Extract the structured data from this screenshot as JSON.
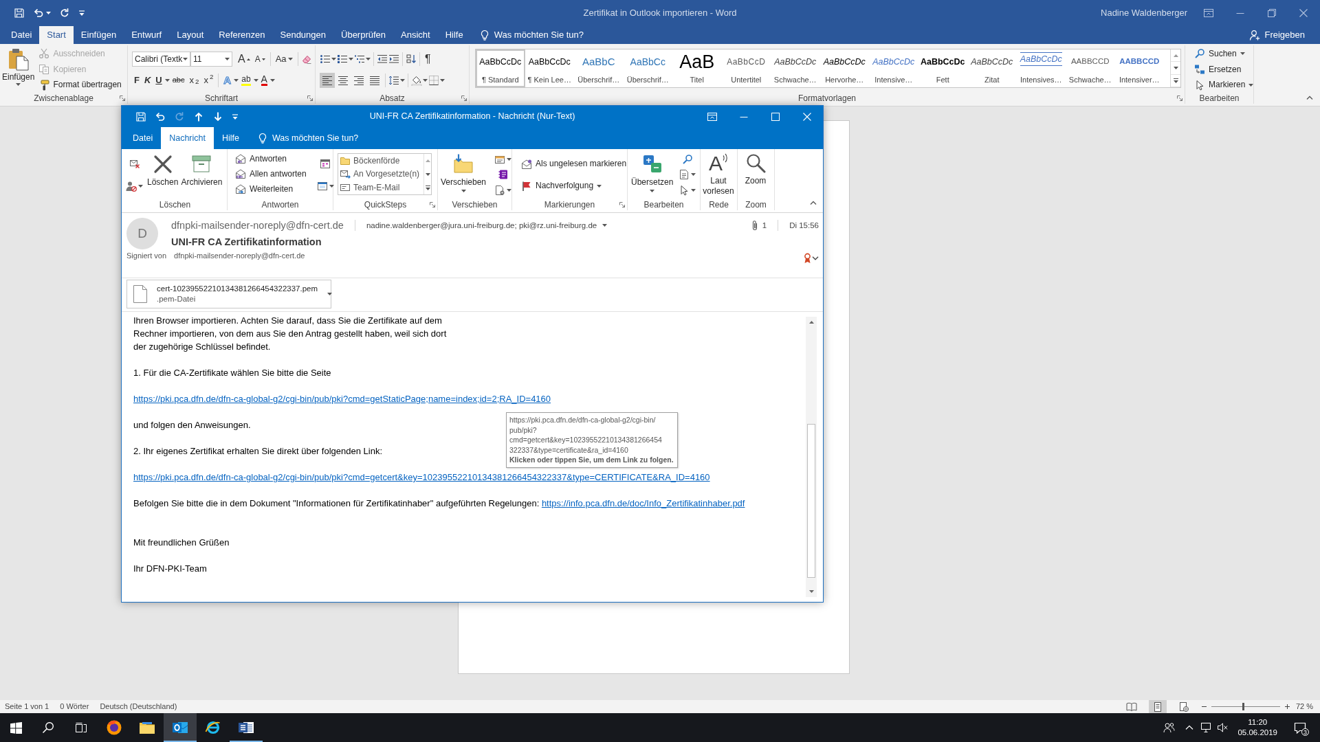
{
  "word": {
    "title": "Zertifikat in Outlook importieren - Word",
    "user": "Nadine Waldenberger",
    "tabs": [
      {
        "label": "Datei",
        "selected": false
      },
      {
        "label": "Start",
        "selected": true
      },
      {
        "label": "Einfügen",
        "selected": false
      },
      {
        "label": "Entwurf",
        "selected": false
      },
      {
        "label": "Layout",
        "selected": false
      },
      {
        "label": "Referenzen",
        "selected": false
      },
      {
        "label": "Sendungen",
        "selected": false
      },
      {
        "label": "Überprüfen",
        "selected": false
      },
      {
        "label": "Ansicht",
        "selected": false
      },
      {
        "label": "Hilfe",
        "selected": false
      }
    ],
    "tell_me": "Was möchten Sie tun?",
    "share": "Freigeben"
  },
  "ribbon": {
    "clipboard": {
      "label": "Zwischenablage",
      "paste": "Einfügen",
      "items": [
        {
          "kind": "cut",
          "label": "Ausschneiden",
          "disabled": true
        },
        {
          "kind": "copy",
          "label": "Kopieren",
          "disabled": true
        },
        {
          "kind": "painter",
          "label": "Format übertragen",
          "disabled": false
        }
      ]
    },
    "font": {
      "label": "Schriftart",
      "name": "Calibri (Textk",
      "size": "11",
      "size_buttons": [
        {
          "kind": "grow",
          "label": "A"
        },
        {
          "kind": "shrink",
          "label": "A"
        }
      ],
      "case": "Aa",
      "format": [
        {
          "kind": "bold",
          "label": "F"
        },
        {
          "kind": "italic",
          "label": "K"
        },
        {
          "kind": "underline",
          "label": "U"
        },
        {
          "kind": "strike",
          "label": "abc"
        },
        {
          "kind": "sub",
          "label": "x$_{2}$"
        },
        {
          "kind": "sup",
          "label": "x$^{2}$"
        }
      ],
      "effects": [
        {
          "kind": "effects",
          "label": "A"
        },
        {
          "kind": "highlight",
          "label": "ab"
        },
        {
          "kind": "color",
          "label": "A"
        }
      ]
    },
    "paragraph": {
      "label": "Absatz",
      "marks": "¶",
      "align": [
        {
          "kind": "left",
          "selected": true
        },
        {
          "kind": "center",
          "selected": false
        },
        {
          "kind": "right",
          "selected": false
        },
        {
          "kind": "justify",
          "selected": false
        }
      ]
    },
    "styles": {
      "label": "Formatvorlagen",
      "items": [
        {
          "kind": "normal",
          "preview": "AaBbCcDc",
          "name": "¶ Standard",
          "selected": true
        },
        {
          "kind": "normal",
          "preview": "AaBbCcDc",
          "name": "¶ Kein Lee…",
          "selected": false
        },
        {
          "kind": "heading",
          "preview": "AaBbC",
          "name": "Überschrif…",
          "selected": false
        },
        {
          "kind": "subheading",
          "preview": "AaBbCc",
          "name": "Überschrif…",
          "selected": false
        },
        {
          "kind": "title",
          "preview": "AaB",
          "name": "Titel",
          "selected": false
        },
        {
          "kind": "subtitle",
          "preview": "AaBbCcD",
          "name": "Untertitel",
          "selected": false
        },
        {
          "kind": "subtle",
          "preview": "AaBbCcDc",
          "name": "Schwache…",
          "selected": false
        },
        {
          "kind": "emphasis",
          "preview": "AaBbCcDc",
          "name": "Hervorhe…",
          "selected": false
        },
        {
          "kind": "intense",
          "preview": "AaBbCcDc",
          "name": "Intensive…",
          "selected": false
        },
        {
          "kind": "strong",
          "preview": "AaBbCcDc",
          "name": "Fett",
          "selected": false
        },
        {
          "kind": "quote",
          "preview": "AaBbCcDc",
          "name": "Zitat",
          "selected": false
        },
        {
          "kind": "intensequote",
          "preview": "AaBbCcDc",
          "name": "Intensives…",
          "selected": false
        },
        {
          "kind": "reference",
          "preview": "AABBCCD",
          "name": "Schwache…",
          "selected": false
        },
        {
          "kind": "intenseref",
          "preview": "AABBCCD",
          "name": "Intensiver…",
          "selected": false
        }
      ]
    },
    "editing": {
      "label": "Bearbeiten",
      "items": [
        {
          "kind": "find",
          "label": "Suchen"
        },
        {
          "kind": "replace",
          "label": "Ersetzen"
        },
        {
          "kind": "select",
          "label": "Markieren"
        }
      ]
    }
  },
  "status_bar": {
    "items": [
      "Seite 1 von 1",
      "0 Wörter",
      "Deutsch (Deutschland)"
    ],
    "views": [
      {
        "kind": "read",
        "selected": false
      },
      {
        "kind": "print",
        "selected": true
      },
      {
        "kind": "web",
        "selected": false
      }
    ],
    "zoom": {
      "level": 0.47,
      "reading": "72 %"
    }
  },
  "outlook": {
    "quick_access": [
      {
        "kind": "save",
        "disabled": false
      },
      {
        "kind": "undo",
        "disabled": false
      },
      {
        "kind": "redo",
        "disabled": true
      },
      {
        "kind": "up",
        "disabled": false
      },
      {
        "kind": "down",
        "disabled": false
      }
    ],
    "title": "UNI-FR CA Zertifikatinformation - Nachricht (Nur-Text)",
    "tabs": [
      {
        "label": "Datei",
        "selected": false
      },
      {
        "label": "Nachricht",
        "selected": true
      },
      {
        "label": "Hilfe",
        "selected": false
      }
    ],
    "tell_me": "Was möchten Sie tun?",
    "ribbon": {
      "delete": {
        "label": "Löschen",
        "buttons": [
          {
            "kind": "delete",
            "label": "Löschen"
          },
          {
            "kind": "archive",
            "label": "Archivieren"
          }
        ]
      },
      "respond": {
        "label": "Antworten",
        "items": [
          {
            "kind": "reply",
            "label": "Antworten"
          },
          {
            "kind": "replyall",
            "label": "Allen antworten"
          },
          {
            "kind": "forward",
            "label": "Weiterleiten"
          }
        ]
      },
      "quicksteps": {
        "label": "QuickSteps",
        "items": [
          {
            "kind": "folder",
            "label": "Böckenförde"
          },
          {
            "kind": "manager",
            "label": "An Vorgesetzte(n)"
          },
          {
            "kind": "team",
            "label": "Team-E-Mail"
          }
        ]
      },
      "move": {
        "label": "Verschieben",
        "button": "Verschieben"
      },
      "tags": {
        "label": "Markierungen",
        "items": [
          {
            "kind": "unread",
            "label": "Als ungelesen markieren"
          },
          {
            "kind": "followup",
            "label": "Nachverfolgung"
          }
        ]
      },
      "editing": {
        "label": "Bearbeiten",
        "button": "Übersetzen"
      },
      "speech": {
        "label": "Rede",
        "glyph": "A",
        "button": "Laut vorlesen"
      },
      "zoom": {
        "label": "Zoom",
        "button": "Zoom"
      }
    },
    "message": {
      "initial": "D",
      "from": "dfnpki-mailsender-noreply@dfn-cert.de",
      "to": "nadine.waldenberger@jura.uni-freiburg.de; pki@rz.uni-freiburg.de",
      "attachment_count": "1",
      "date": "Di 15:56",
      "subject": "UNI-FR CA Zertifikatinformation",
      "signed_label": "Signiert von",
      "signed_by": "dfnpki-mailsender-noreply@dfn-cert.de",
      "attachments": [
        {
          "name": "cert-10239552210134381266454322337.pem",
          "type": ".pem-Datei"
        }
      ],
      "body": [
        {
          "kind": "text",
          "lines": [
            "Ihren Browser importieren. Achten Sie darauf, dass Sie die Zertifikate auf dem",
            "Rechner importieren, von dem aus Sie den Antrag gestellt haben, weil sich dort",
            "der zugehörige Schlüssel befindet."
          ]
        },
        {
          "kind": "text",
          "lines": [
            "1. Für die CA-Zertifikate wählen Sie bitte die Seite"
          ]
        },
        {
          "kind": "link",
          "url": "https://pki.pca.dfn.de/dfn-ca-global-g2/cgi-bin/pub/pki?cmd=getStaticPage;name=index;id=2;RA_ID=4160"
        },
        {
          "kind": "text",
          "lines": [
            "und folgen den Anweisungen."
          ]
        },
        {
          "kind": "text",
          "lines": [
            "2. Ihr eigenes Zertifikat erhalten Sie direkt über folgenden Link:"
          ]
        },
        {
          "kind": "link",
          "url": "https://pki.pca.dfn.de/dfn-ca-global-g2/cgi-bin/pub/pki?cmd=getcert&key=10239552210134381266454322337&type=CERTIFICATE&RA_ID=4160"
        },
        {
          "kind": "mixed",
          "text": "Befolgen Sie bitte die in dem Dokument \"Informationen für Zertifikatinhaber\" aufgeführten Regelungen:",
          "url": "https://info.pca.dfn.de/doc/Info_Zertifikatinhaber.pdf"
        },
        {
          "kind": "blank"
        },
        {
          "kind": "text",
          "lines": [
            "Mit freundlichen Grüßen"
          ]
        },
        {
          "kind": "text",
          "lines": [
            "Ihr DFN-PKI-Team"
          ]
        }
      ]
    },
    "tooltip": {
      "lines": [
        "https://pki.pca.dfn.de/dfn-ca-global-g2/cgi-bin/",
        "pub/pki?",
        "cmd=getcert&key=10239552210134381266454",
        "322337&type=certificate&ra_id=4160"
      ],
      "hint": "Klicken oder tippen Sie, um dem Link zu folgen."
    }
  },
  "taskbar": {
    "apps": [
      {
        "kind": "firefox",
        "running": false,
        "selected": false
      },
      {
        "kind": "explorer",
        "running": false,
        "selected": false
      },
      {
        "kind": "outlook",
        "running": true,
        "selected": true
      },
      {
        "kind": "ie",
        "running": false,
        "selected": false
      },
      {
        "kind": "word",
        "running": true,
        "selected": false
      }
    ],
    "volume": {
      "muted": true
    },
    "time": "11:20",
    "date": "05.06.2019",
    "notifications": "3"
  }
}
